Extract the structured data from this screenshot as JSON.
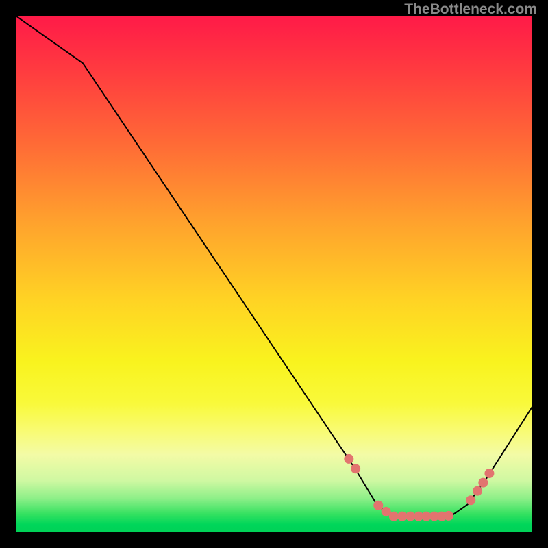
{
  "attribution": "TheBottleneck.com",
  "gradient": {
    "stops": [
      {
        "offset": 0.0,
        "color": "#ff1a48"
      },
      {
        "offset": 0.1,
        "color": "#ff3940"
      },
      {
        "offset": 0.25,
        "color": "#ff6b36"
      },
      {
        "offset": 0.4,
        "color": "#ffa22d"
      },
      {
        "offset": 0.55,
        "color": "#ffd324"
      },
      {
        "offset": 0.67,
        "color": "#f9f31e"
      },
      {
        "offset": 0.75,
        "color": "#f9f93a"
      },
      {
        "offset": 0.8,
        "color": "#f9fb6f"
      },
      {
        "offset": 0.85,
        "color": "#f3fba6"
      },
      {
        "offset": 0.9,
        "color": "#cff8a2"
      },
      {
        "offset": 0.935,
        "color": "#8cef88"
      },
      {
        "offset": 0.965,
        "color": "#34e160"
      },
      {
        "offset": 0.985,
        "color": "#00d65a"
      },
      {
        "offset": 1.0,
        "color": "#00d157"
      }
    ]
  },
  "chart_data": {
    "type": "line",
    "title": "",
    "xlabel": "",
    "ylabel": "",
    "xlim": [
      0,
      100
    ],
    "ylim": [
      0,
      100
    ],
    "series": [
      {
        "name": "bottleneck-curve",
        "x": [
          0.0,
          13.0,
          65.7,
          70.0,
          73.0,
          84.2,
          87.5,
          91.0,
          100.0
        ],
        "y": [
          100.0,
          90.8,
          12.3,
          5.2,
          3.1,
          3.1,
          5.4,
          10.2,
          24.3
        ]
      }
    ],
    "markers": {
      "name": "highlighted-points",
      "color": "#e2746f",
      "x": [
        64.5,
        65.8,
        70.2,
        71.7,
        73.2,
        74.8,
        76.4,
        78.0,
        79.5,
        81.0,
        82.5,
        83.8,
        88.1,
        89.4,
        90.5,
        91.7
      ],
      "y": [
        14.2,
        12.3,
        5.2,
        4.0,
        3.1,
        3.1,
        3.1,
        3.1,
        3.1,
        3.1,
        3.1,
        3.2,
        6.2,
        8.0,
        9.6,
        11.4
      ]
    },
    "grid": false,
    "legend": false
  }
}
